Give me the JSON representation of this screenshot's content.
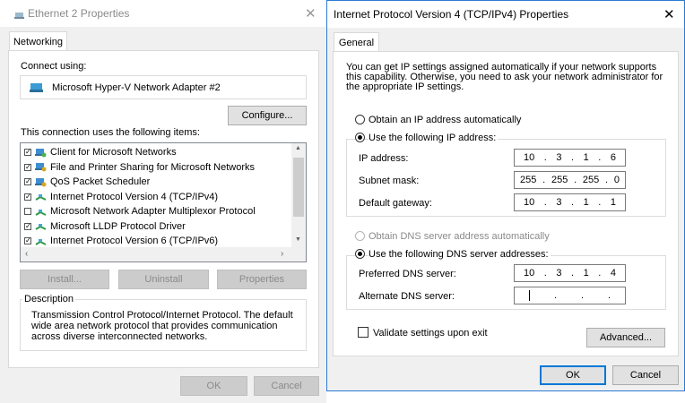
{
  "left_dialog": {
    "title": "Ethernet 2 Properties",
    "tab": "Networking",
    "connect_using_label": "Connect using:",
    "adapter_name": "Microsoft Hyper-V Network Adapter #2",
    "configure_label": "Configure...",
    "items_label": "This connection uses the following items:",
    "items": [
      {
        "label": "Client for Microsoft Networks",
        "checked": true,
        "icon": "network-client-icon"
      },
      {
        "label": "File and Printer Sharing for Microsoft Networks",
        "checked": true,
        "icon": "network-service-icon"
      },
      {
        "label": "QoS Packet Scheduler",
        "checked": true,
        "icon": "network-service-icon"
      },
      {
        "label": "Internet Protocol Version 4 (TCP/IPv4)",
        "checked": true,
        "icon": "network-protocol-icon"
      },
      {
        "label": "Microsoft Network Adapter Multiplexor Protocol",
        "checked": false,
        "icon": "network-protocol-icon"
      },
      {
        "label": "Microsoft LLDP Protocol Driver",
        "checked": true,
        "icon": "network-protocol-icon"
      },
      {
        "label": "Internet Protocol Version 6 (TCP/IPv6)",
        "checked": true,
        "icon": "network-protocol-icon"
      }
    ],
    "install_label": "Install...",
    "uninstall_label": "Uninstall",
    "properties_label": "Properties",
    "description_label": "Description",
    "description_text": "Transmission Control Protocol/Internet Protocol. The default wide area network protocol that provides communication across diverse interconnected networks.",
    "ok_label": "OK",
    "cancel_label": "Cancel"
  },
  "right_dialog": {
    "title": "Internet Protocol Version 4 (TCP/IPv4) Properties",
    "tab": "General",
    "intro_text": "You can get IP settings assigned automatically if your network supports this capability. Otherwise, you need to ask your network administrator for the appropriate IP settings.",
    "obtain_ip_auto_label": "Obtain an IP address automatically",
    "use_following_ip_label": "Use the following IP address:",
    "ip_address_label": "IP address:",
    "ip_address": [
      "10",
      "3",
      "1",
      "6"
    ],
    "subnet_mask_label": "Subnet mask:",
    "subnet_mask": [
      "255",
      "255",
      "255",
      "0"
    ],
    "gateway_label": "Default gateway:",
    "gateway": [
      "10",
      "3",
      "1",
      "1"
    ],
    "obtain_dns_auto_label": "Obtain DNS server address automatically",
    "use_following_dns_label": "Use the following DNS server addresses:",
    "preferred_dns_label": "Preferred DNS server:",
    "preferred_dns": [
      "10",
      "3",
      "1",
      "4"
    ],
    "alternate_dns_label": "Alternate DNS server:",
    "alternate_dns": [
      "",
      "",
      "",
      ""
    ],
    "validate_label": "Validate settings upon exit",
    "advanced_label": "Advanced...",
    "ok_label": "OK",
    "cancel_label": "Cancel"
  },
  "colors": {
    "accent": "#0078d7",
    "dialog_bg": "#f0f0f0",
    "disabled_text": "#8a8a8a"
  }
}
